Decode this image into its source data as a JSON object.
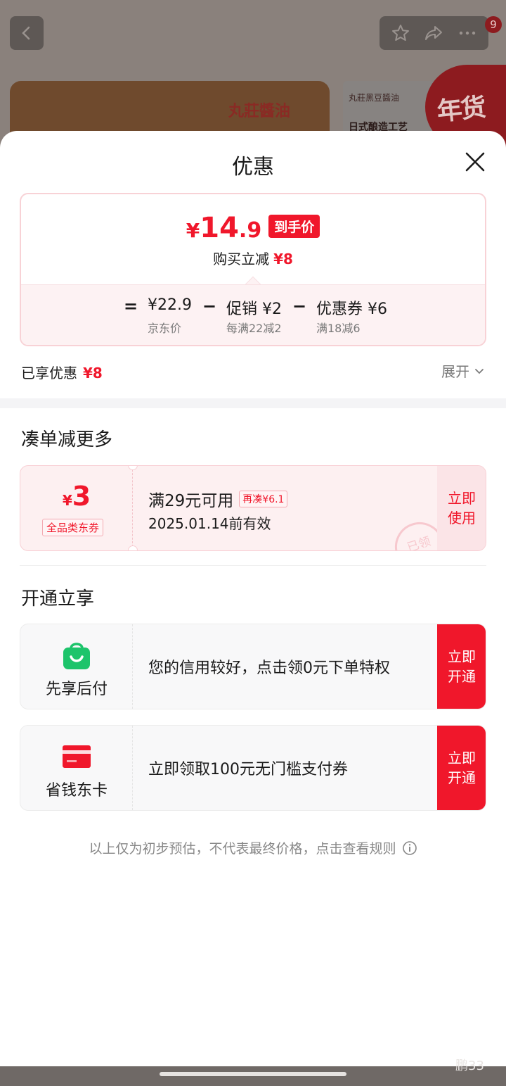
{
  "background": {
    "cart_count": "9",
    "banner_brand": "丸莊醬油",
    "tile_brand": "丸莊黑豆醬油",
    "tile_caption": "日式酿造工艺",
    "festival": "年货节"
  },
  "sheet": {
    "title": "优惠",
    "price_card": {
      "yen": "¥",
      "price_int": "14",
      "price_dec": ".9",
      "tag": "到手价",
      "save_label": "购买立减",
      "save_value": "¥8",
      "equals": "=",
      "base_price": "¥22.9",
      "base_label": "京东价",
      "minus1": "−",
      "promo": "促销 ¥2",
      "promo_label": "每满22减2",
      "minus2": "−",
      "coupon": "优惠券 ¥6",
      "coupon_label": "满18减6"
    },
    "enjoyed_label": "已享优惠",
    "enjoyed_value": "¥8",
    "expand_label": "展开"
  },
  "combine": {
    "title": "凑单减更多",
    "coupon": {
      "yen": "¥",
      "amount": "3",
      "type": "全品类东券",
      "condition": "满29元可用",
      "more": "再凑¥6.1",
      "valid": "2025.01.14前有效",
      "stamp": "已领",
      "action_line1": "立即",
      "action_line2": "使用"
    }
  },
  "open": {
    "title": "开通立享",
    "items": [
      {
        "name": "先享后付",
        "desc": "您的信用较好，点击领0元下单特权",
        "action_line1": "立即",
        "action_line2": "开通"
      },
      {
        "name": "省钱东卡",
        "desc": "立即领取100元无门槛支付券",
        "action_line1": "立即",
        "action_line2": "开通"
      }
    ]
  },
  "disclaimer": "以上仅为初步预估，不代表最终价格，点击查看规则",
  "watermark": "鹏33",
  "colors": {
    "accent": "#f0172b",
    "green": "#1dc46b",
    "card_pink": "#fdf0f1"
  }
}
